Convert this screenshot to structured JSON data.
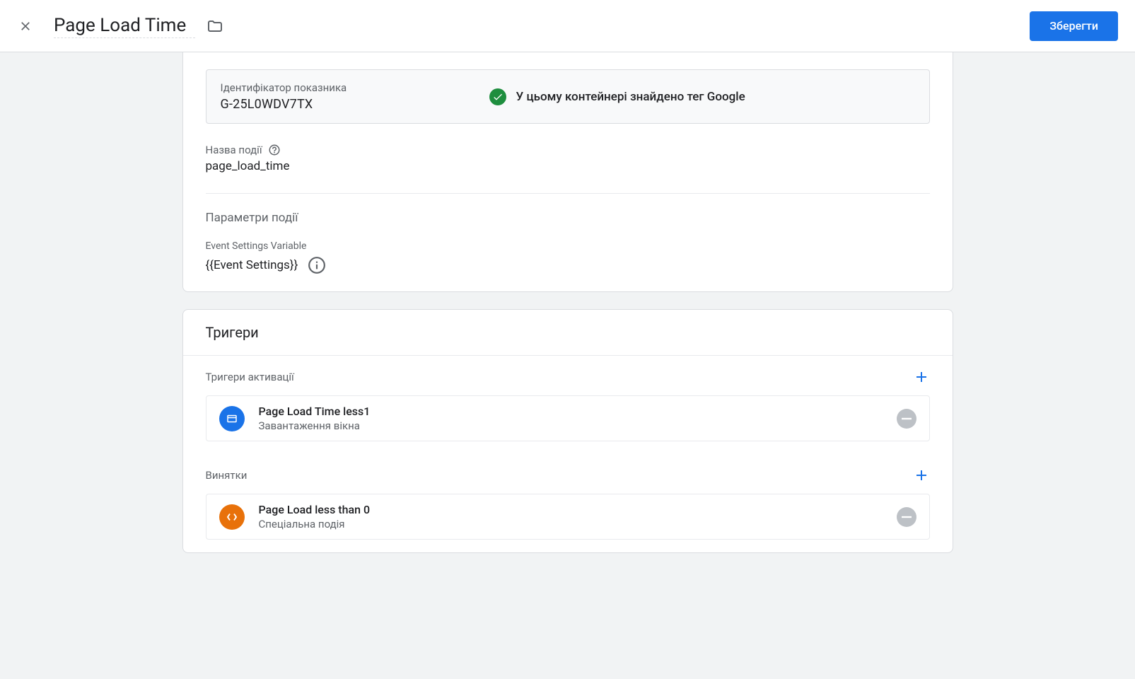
{
  "header": {
    "title": "Page Load Time",
    "save_label": "Зберегти"
  },
  "tag_config": {
    "id_label": "Ідентифікатор показника",
    "id_value": "G-25L0WDV7TX",
    "google_tag_found": "У цьому контейнері знайдено тег Google",
    "event_name_label": "Назва події",
    "event_name_value": "page_load_time",
    "event_params_title": "Параметри події",
    "settings_var_label": "Event Settings Variable",
    "settings_var_value": "{{Event Settings}}"
  },
  "triggers": {
    "title": "Тригери",
    "activation_label": "Тригери активації",
    "exceptions_label": "Винятки",
    "activation_items": [
      {
        "name": "Page Load Time less1",
        "type": "Завантаження вікна"
      }
    ],
    "exception_items": [
      {
        "name": "Page Load less than 0",
        "type": "Спеціальна подія"
      }
    ]
  }
}
